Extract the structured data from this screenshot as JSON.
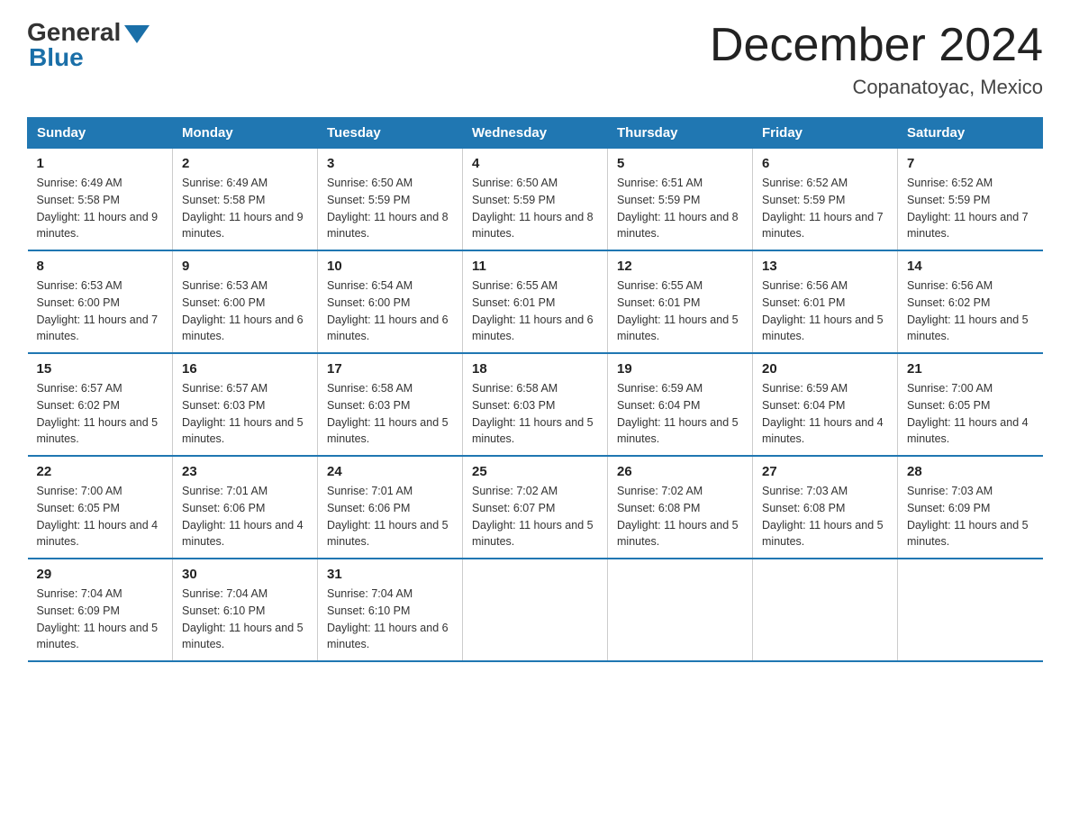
{
  "header": {
    "logo_text_general": "General",
    "logo_text_blue": "Blue",
    "month_title": "December 2024",
    "location": "Copanatoyac, Mexico"
  },
  "days_of_week": [
    "Sunday",
    "Monday",
    "Tuesday",
    "Wednesday",
    "Thursday",
    "Friday",
    "Saturday"
  ],
  "weeks": [
    [
      {
        "num": "1",
        "sunrise": "6:49 AM",
        "sunset": "5:58 PM",
        "daylight": "11 hours and 9 minutes."
      },
      {
        "num": "2",
        "sunrise": "6:49 AM",
        "sunset": "5:58 PM",
        "daylight": "11 hours and 9 minutes."
      },
      {
        "num": "3",
        "sunrise": "6:50 AM",
        "sunset": "5:59 PM",
        "daylight": "11 hours and 8 minutes."
      },
      {
        "num": "4",
        "sunrise": "6:50 AM",
        "sunset": "5:59 PM",
        "daylight": "11 hours and 8 minutes."
      },
      {
        "num": "5",
        "sunrise": "6:51 AM",
        "sunset": "5:59 PM",
        "daylight": "11 hours and 8 minutes."
      },
      {
        "num": "6",
        "sunrise": "6:52 AM",
        "sunset": "5:59 PM",
        "daylight": "11 hours and 7 minutes."
      },
      {
        "num": "7",
        "sunrise": "6:52 AM",
        "sunset": "5:59 PM",
        "daylight": "11 hours and 7 minutes."
      }
    ],
    [
      {
        "num": "8",
        "sunrise": "6:53 AM",
        "sunset": "6:00 PM",
        "daylight": "11 hours and 7 minutes."
      },
      {
        "num": "9",
        "sunrise": "6:53 AM",
        "sunset": "6:00 PM",
        "daylight": "11 hours and 6 minutes."
      },
      {
        "num": "10",
        "sunrise": "6:54 AM",
        "sunset": "6:00 PM",
        "daylight": "11 hours and 6 minutes."
      },
      {
        "num": "11",
        "sunrise": "6:55 AM",
        "sunset": "6:01 PM",
        "daylight": "11 hours and 6 minutes."
      },
      {
        "num": "12",
        "sunrise": "6:55 AM",
        "sunset": "6:01 PM",
        "daylight": "11 hours and 5 minutes."
      },
      {
        "num": "13",
        "sunrise": "6:56 AM",
        "sunset": "6:01 PM",
        "daylight": "11 hours and 5 minutes."
      },
      {
        "num": "14",
        "sunrise": "6:56 AM",
        "sunset": "6:02 PM",
        "daylight": "11 hours and 5 minutes."
      }
    ],
    [
      {
        "num": "15",
        "sunrise": "6:57 AM",
        "sunset": "6:02 PM",
        "daylight": "11 hours and 5 minutes."
      },
      {
        "num": "16",
        "sunrise": "6:57 AM",
        "sunset": "6:03 PM",
        "daylight": "11 hours and 5 minutes."
      },
      {
        "num": "17",
        "sunrise": "6:58 AM",
        "sunset": "6:03 PM",
        "daylight": "11 hours and 5 minutes."
      },
      {
        "num": "18",
        "sunrise": "6:58 AM",
        "sunset": "6:03 PM",
        "daylight": "11 hours and 5 minutes."
      },
      {
        "num": "19",
        "sunrise": "6:59 AM",
        "sunset": "6:04 PM",
        "daylight": "11 hours and 5 minutes."
      },
      {
        "num": "20",
        "sunrise": "6:59 AM",
        "sunset": "6:04 PM",
        "daylight": "11 hours and 4 minutes."
      },
      {
        "num": "21",
        "sunrise": "7:00 AM",
        "sunset": "6:05 PM",
        "daylight": "11 hours and 4 minutes."
      }
    ],
    [
      {
        "num": "22",
        "sunrise": "7:00 AM",
        "sunset": "6:05 PM",
        "daylight": "11 hours and 4 minutes."
      },
      {
        "num": "23",
        "sunrise": "7:01 AM",
        "sunset": "6:06 PM",
        "daylight": "11 hours and 4 minutes."
      },
      {
        "num": "24",
        "sunrise": "7:01 AM",
        "sunset": "6:06 PM",
        "daylight": "11 hours and 5 minutes."
      },
      {
        "num": "25",
        "sunrise": "7:02 AM",
        "sunset": "6:07 PM",
        "daylight": "11 hours and 5 minutes."
      },
      {
        "num": "26",
        "sunrise": "7:02 AM",
        "sunset": "6:08 PM",
        "daylight": "11 hours and 5 minutes."
      },
      {
        "num": "27",
        "sunrise": "7:03 AM",
        "sunset": "6:08 PM",
        "daylight": "11 hours and 5 minutes."
      },
      {
        "num": "28",
        "sunrise": "7:03 AM",
        "sunset": "6:09 PM",
        "daylight": "11 hours and 5 minutes."
      }
    ],
    [
      {
        "num": "29",
        "sunrise": "7:04 AM",
        "sunset": "6:09 PM",
        "daylight": "11 hours and 5 minutes."
      },
      {
        "num": "30",
        "sunrise": "7:04 AM",
        "sunset": "6:10 PM",
        "daylight": "11 hours and 5 minutes."
      },
      {
        "num": "31",
        "sunrise": "7:04 AM",
        "sunset": "6:10 PM",
        "daylight": "11 hours and 6 minutes."
      },
      null,
      null,
      null,
      null
    ]
  ]
}
